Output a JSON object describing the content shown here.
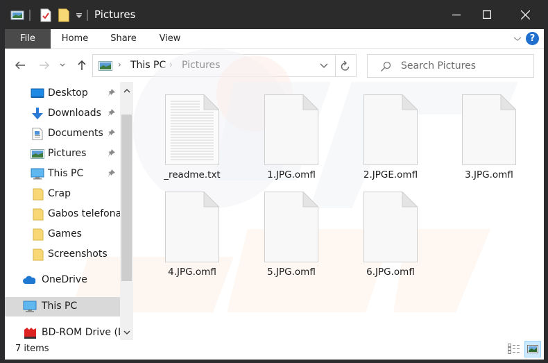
{
  "window": {
    "title": "Pictures",
    "controls": {
      "minimize": "minimize",
      "maximize": "maximize",
      "close": "close"
    }
  },
  "ribbon": {
    "tabs": [
      {
        "label": "File"
      },
      {
        "label": "Home"
      },
      {
        "label": "Share"
      },
      {
        "label": "View"
      }
    ],
    "help_label": "?"
  },
  "address": {
    "crumbs": [
      "This PC",
      "Pictures"
    ],
    "separator": "›"
  },
  "search": {
    "placeholder": "Search Pictures"
  },
  "sidebar": {
    "items": [
      {
        "label": "Desktop",
        "icon": "desktop-icon",
        "pinned": true
      },
      {
        "label": "Downloads",
        "icon": "downloads-icon",
        "pinned": true
      },
      {
        "label": "Documents",
        "icon": "documents-icon",
        "pinned": true
      },
      {
        "label": "Pictures",
        "icon": "pictures-icon",
        "pinned": true
      },
      {
        "label": "This PC",
        "icon": "this-pc-icon",
        "pinned": true
      },
      {
        "label": "Crap",
        "icon": "folder-icon",
        "pinned": false
      },
      {
        "label": "Gabos telefonas",
        "icon": "folder-icon",
        "pinned": false
      },
      {
        "label": "Games",
        "icon": "folder-icon",
        "pinned": false
      },
      {
        "label": "Screenshots",
        "icon": "folder-icon",
        "pinned": false
      },
      {
        "label": "OneDrive",
        "icon": "onedrive-icon",
        "pinned": false
      },
      {
        "label": "This PC",
        "icon": "this-pc-icon",
        "pinned": false,
        "selected": true
      },
      {
        "label": "BD-ROM Drive (D:",
        "icon": "bd-rom-icon",
        "pinned": false
      }
    ]
  },
  "files": [
    {
      "name": "_readme.txt",
      "type": "text"
    },
    {
      "name": "1.JPG.omfl",
      "type": "blank"
    },
    {
      "name": "2.JPGE.omfl",
      "type": "blank"
    },
    {
      "name": "3.JPG.omfl",
      "type": "blank"
    },
    {
      "name": "4.JPG.omfl",
      "type": "blank"
    },
    {
      "name": "5.JPG.omfl",
      "type": "blank"
    },
    {
      "name": "6.JPG.omfl",
      "type": "blank"
    }
  ],
  "status": {
    "item_count": "7 items"
  },
  "colors": {
    "titlebar": "#2b2b2b",
    "file_tab": "#4a4a4a",
    "selection": "#d9d9d9",
    "accent": "#1f6fcf",
    "folder": "#f8d775"
  }
}
